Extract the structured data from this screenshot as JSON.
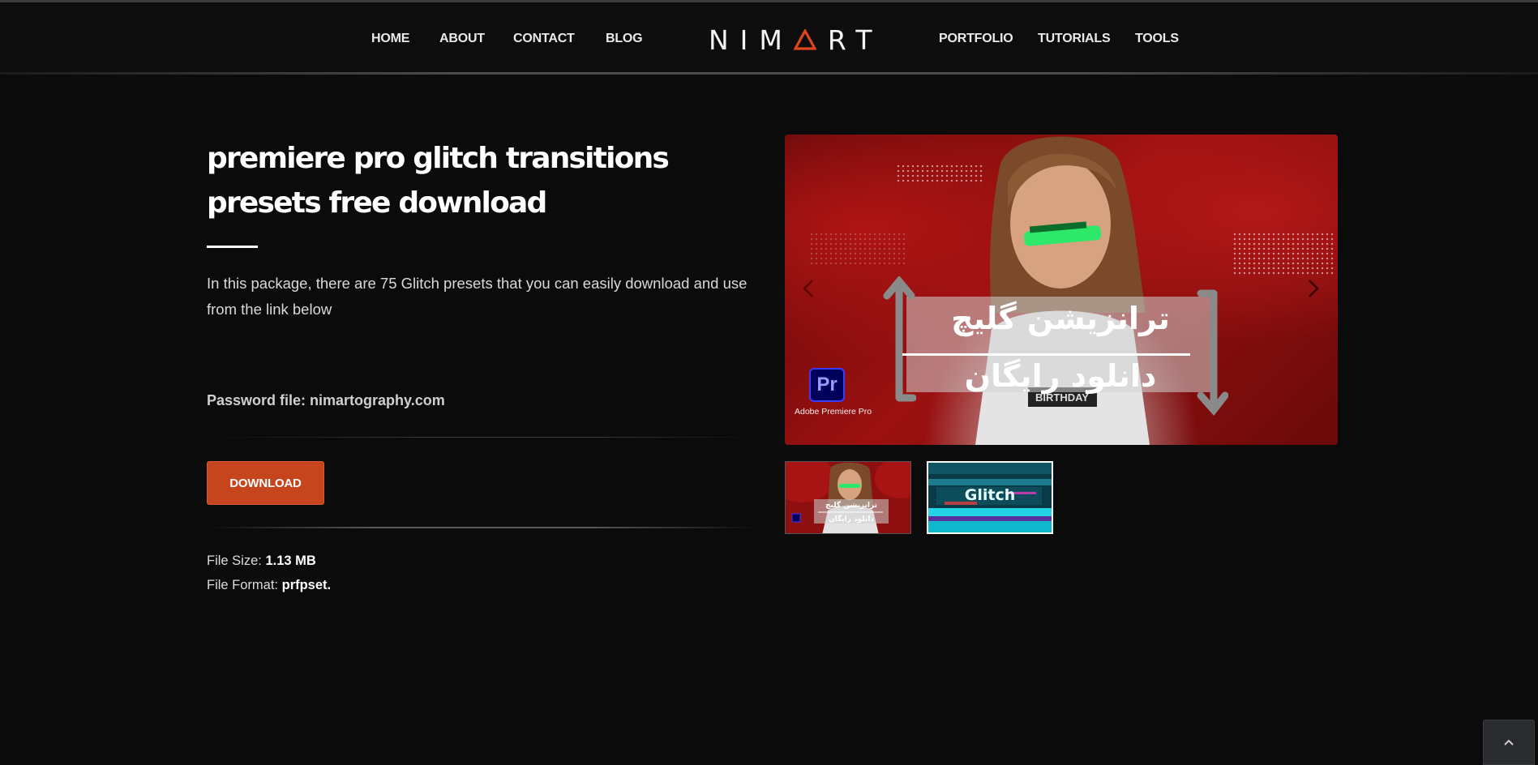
{
  "nav": {
    "left": [
      "HOME",
      "ABOUT",
      "CONTACT",
      "BLOG"
    ],
    "right": [
      "PORTFOLIO",
      "TUTORIALS",
      "TOOLS"
    ],
    "logo_text_left": "NIM",
    "logo_text_right": "RT",
    "logo_accent_color": "#e0451c"
  },
  "post": {
    "title": "premiere pro glitch transitions presets free download",
    "description": "In this package, there are 75 Glitch presets that you can easily download and use from the link below",
    "password": "Password file: nimartography.com",
    "download_label": "DOWNLOAD",
    "file_size_label": "File Size:",
    "file_size_value": "1.13 MB",
    "file_format_label": "File Format:",
    "file_format_value": "prfpset."
  },
  "slider": {
    "persian_line1": "ترانزیشن گلیچ",
    "persian_line2": "دانلود رایگان",
    "app_badge": "Pr",
    "app_name": "Adobe Premiere Pro",
    "shirt_text": "BIRTHDAY",
    "thumb2_title": "Glitch",
    "accent_color": "#b01414"
  },
  "colors": {
    "button": "#c7451c",
    "background": "#0b0b0c"
  }
}
